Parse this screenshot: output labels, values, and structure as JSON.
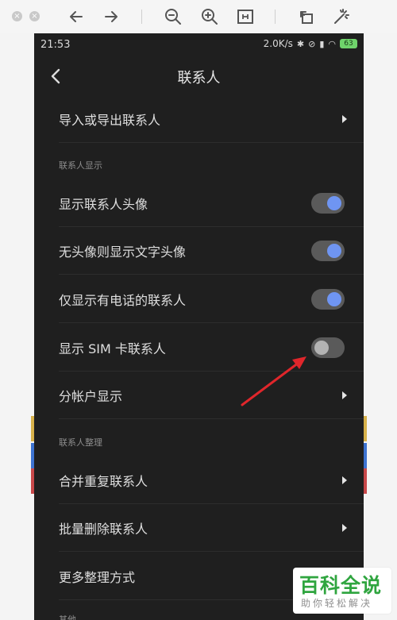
{
  "status_bar": {
    "time": "21:53",
    "net_speed": "2.0K/s",
    "battery": "63"
  },
  "header": {
    "title": "联系人"
  },
  "rows": {
    "import_export": "导入或导出联系人",
    "section_display": "联系人显示",
    "show_avatar": "显示联系人头像",
    "show_text_avatar": "无头像则显示文字头像",
    "show_phone_only": "仅显示有电话的联系人",
    "show_sim": "显示 SIM 卡联系人",
    "account_display": "分帐户显示",
    "section_organize": "联系人整理",
    "merge_duplicates": "合并重复联系人",
    "batch_delete": "批量删除联系人",
    "more_organize": "更多整理方式",
    "section_other": "其他"
  },
  "toggles": {
    "show_avatar": true,
    "show_text_avatar": true,
    "show_phone_only": true,
    "show_sim": false
  },
  "watermark": {
    "title": "百科全说",
    "subtitle": "助你轻松解决"
  },
  "colors": {
    "background": "#1f1f1f",
    "toggle_on": "#6f95f2",
    "toggle_track": "#5a5a5a",
    "annotation_arrow": "#e0262b",
    "watermark_green": "#2fa53f"
  },
  "icons": [
    "close-icon",
    "minimize-icon",
    "back-arrow-icon",
    "forward-arrow-icon",
    "zoom-out-icon",
    "zoom-in-icon",
    "fit-page-icon",
    "rotate-icon",
    "magic-wand-icon",
    "bluetooth-icon",
    "mute-icon",
    "signal-icon",
    "wifi-icon",
    "battery-icon",
    "chevron-left-icon",
    "chevron-right-icon"
  ]
}
